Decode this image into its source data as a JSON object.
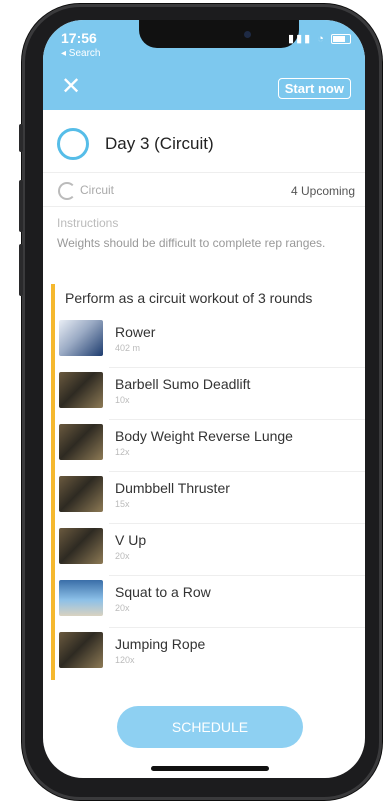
{
  "status": {
    "time": "17:56",
    "back_label": "◂ Search"
  },
  "header": {
    "start_label": "Start now"
  },
  "day": {
    "title": "Day 3 (Circuit)"
  },
  "circuit": {
    "label": "Circuit",
    "upcoming": "4 Upcoming"
  },
  "instructions": {
    "label": "Instructions",
    "text": "Weights should be difficult to complete rep ranges."
  },
  "block": {
    "title": "Perform as a circuit workout of 3 rounds",
    "exercises": [
      {
        "name": "Rower",
        "meta": "402 m"
      },
      {
        "name": "Barbell Sumo Deadlift",
        "meta": "10x"
      },
      {
        "name": "Body Weight Reverse Lunge",
        "meta": "12x"
      },
      {
        "name": "Dumbbell Thruster",
        "meta": "15x"
      },
      {
        "name": "V Up",
        "meta": "20x"
      },
      {
        "name": "Squat to a Row",
        "meta": "20x"
      },
      {
        "name": "Jumping Rope",
        "meta": "120x"
      }
    ]
  },
  "footer": {
    "schedule_label": "SCHEDULE"
  },
  "colors": {
    "header": "#7dc8ee",
    "accent": "#f5b82e",
    "button": "#8ed0f2"
  }
}
